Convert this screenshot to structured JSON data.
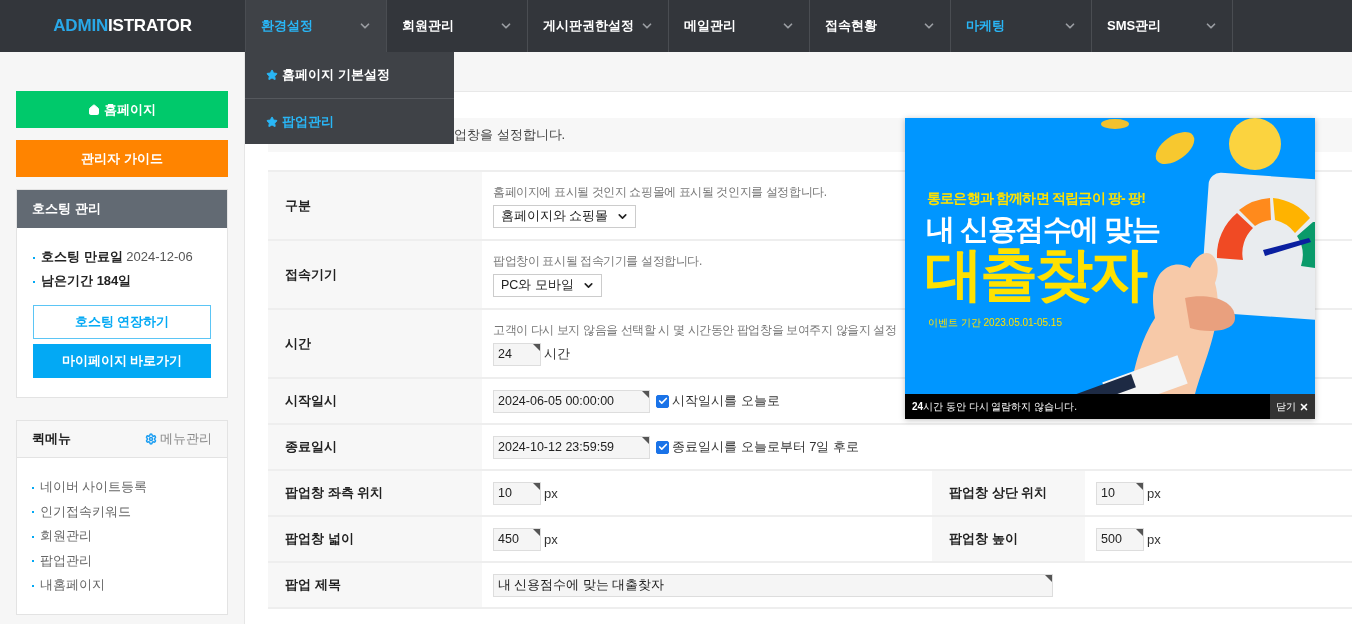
{
  "logo": {
    "accent": "ADMIN",
    "rest": "ISTRATOR"
  },
  "nav": [
    {
      "label": "환경설정",
      "open": true,
      "highlighted": true
    },
    {
      "label": "회원관리",
      "open": false,
      "highlighted": false
    },
    {
      "label": "게시판권한설정",
      "open": false,
      "highlighted": false
    },
    {
      "label": "메일관리",
      "open": false,
      "highlighted": false
    },
    {
      "label": "접속현황",
      "open": false,
      "highlighted": false
    },
    {
      "label": "마케팅",
      "open": false,
      "highlighted": true
    },
    {
      "label": "SMS관리",
      "open": false,
      "highlighted": false
    }
  ],
  "dropdown": [
    {
      "label": "홈페이지 기본설정",
      "selected": false
    },
    {
      "label": "팝업관리",
      "selected": true
    }
  ],
  "sidebar": {
    "buttons": [
      {
        "label": "홈페이지",
        "kind": "home"
      },
      {
        "label": "관리자 가이드",
        "kind": "guide"
      }
    ],
    "hosting": {
      "title": "호스팅 관리",
      "items": [
        {
          "label": "호스팅 만료일",
          "value": "2024-12-06",
          "value_bold": false
        },
        {
          "label": "남은기간",
          "value": "184일",
          "value_bold": true
        }
      ],
      "buttons": [
        {
          "label": "호스팅 연장하기",
          "kind": "outline"
        },
        {
          "label": "마이페이지 바로가기",
          "kind": "filled"
        }
      ]
    },
    "quick_menu": {
      "title": "퀵메뉴",
      "manage": "메뉴관리",
      "items": [
        "네이버 사이트등록",
        "인기접속키워드",
        "회원관리",
        "팝업관리",
        "내홈페이지"
      ]
    }
  },
  "description": "업창을 설정합니다.",
  "form": [
    {
      "kind": "select",
      "label": "구분",
      "help": "홈페이지에 표시될 것인지 쇼핑몰에 표시될 것인지를 설정합니다.",
      "value": "홈페이지와 쇼핑몰"
    },
    {
      "kind": "select",
      "label": "접속기기",
      "help": "팝업창이 표시될 접속기기를 설정합니다.",
      "value": "PC와 모바일"
    },
    {
      "kind": "number",
      "label": "시간",
      "help": "고객이 다시 보지 않음을 선택할 시 몇 시간동안 팝업창을 보여주지 않을지 설정",
      "value": "24",
      "unit": "시간"
    },
    {
      "kind": "datetime",
      "label": "시작일시",
      "value": "2024-06-05 00:00:00",
      "checkbox": {
        "label": "시작일시를 오늘로",
        "checked": true
      }
    },
    {
      "kind": "datetime",
      "label": "종료일시",
      "value": "2024-10-12 23:59:59",
      "checkbox": {
        "label": "종료일시를 오늘로부터 7일 후로",
        "checked": true
      }
    },
    {
      "kind": "pair",
      "fields": [
        {
          "label": "팝업창 좌측 위치",
          "value": "10",
          "unit": "px"
        },
        {
          "label": "팝업창 상단 위치",
          "value": "10",
          "unit": "px"
        }
      ]
    },
    {
      "kind": "pair",
      "fields": [
        {
          "label": "팝업창 넓이",
          "value": "450",
          "unit": "px"
        },
        {
          "label": "팝업창 높이",
          "value": "500",
          "unit": "px"
        }
      ]
    },
    {
      "kind": "text",
      "label": "팝업 제목",
      "value": "내 신용점수에 맞는 대출찾자"
    }
  ],
  "popup": {
    "banner": {
      "kind": "picture",
      "tagline": "통로은행과 함께하면 적립금이 팡- 팡!",
      "headline": "내 신용점수에 맞는",
      "title": "대출찾자",
      "period": "이벤트 기간  2023.05.01-05.15"
    },
    "notice": "**24**시간 동안 다시 열람하지 않습니다.",
    "close": "닫기"
  }
}
